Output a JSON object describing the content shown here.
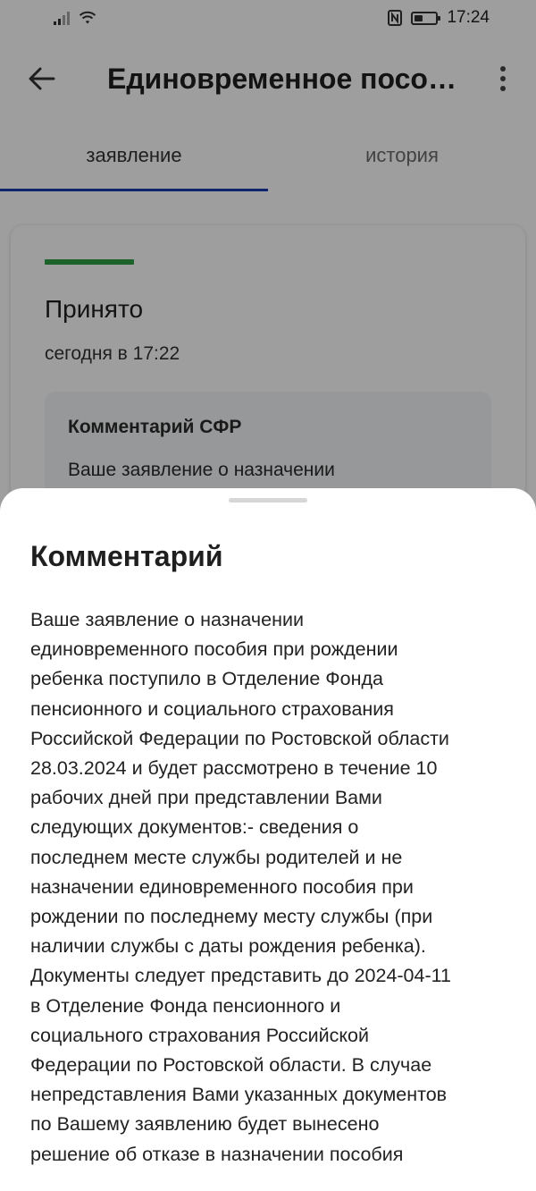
{
  "status_bar": {
    "time": "17:24",
    "icons": [
      "signal-icon",
      "wifi-icon",
      "nfc-icon",
      "battery-icon"
    ]
  },
  "app_bar": {
    "title": "Единовременное пособие при рождении ребенка",
    "back_icon": "arrow-left-icon",
    "menu_icon": "more-vertical-icon"
  },
  "tabs": [
    {
      "label": "заявление",
      "active": true
    },
    {
      "label": "история",
      "active": false
    }
  ],
  "status_card": {
    "accent_color": "#2f9e44",
    "status": "Принято",
    "date": "сегодня в 17:22",
    "comment_title": "Комментарий СФР",
    "comment_preview": "Ваше заявление о назначении"
  },
  "sheet": {
    "title": "Комментарий",
    "lines": [
      "Ваше заявление о назначении",
      "единовременного пособия при рождении",
      "ребенка поступило в Отделение Фонда",
      "пенсионного и социального страхования",
      "Российской Федерации по Ростовской области",
      "28.03.2024 и будет рассмотрено в течение 10",
      "рабочих дней при представлении Вами",
      "следующих документов:- сведения о",
      "последнем месте службы родителей и не",
      "назначении единовременного пособия при",
      "рождении по последнему месту службы (при",
      "наличии службы с даты рождения ребенка).",
      "Документы следует представить до 2024-04-11",
      "в Отделение Фонда пенсионного и",
      "социального страхования Российской",
      "Федерации по Ростовской области. В случае",
      "непредставления Вами указанных документов",
      "по Вашему заявлению будет вынесено",
      "решение об отказе в назначении пособия"
    ]
  }
}
